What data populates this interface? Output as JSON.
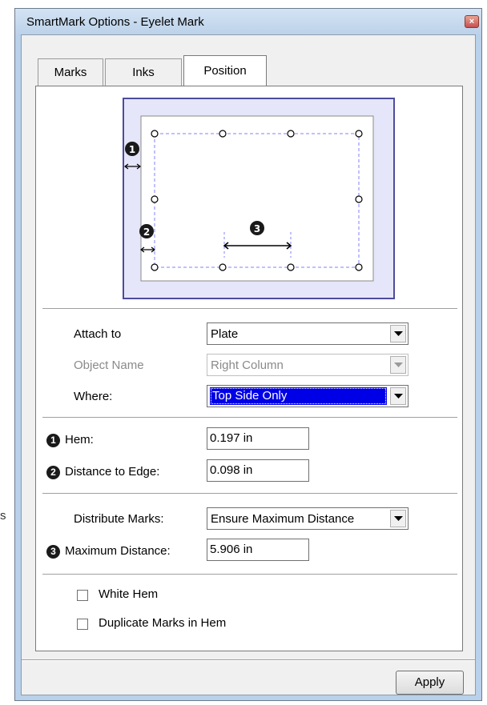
{
  "window": {
    "title": "SmartMark Options - Eyelet Mark",
    "close_symbol": "×"
  },
  "tabs": [
    {
      "label": "Marks",
      "active": false
    },
    {
      "label": "Inks",
      "active": false
    },
    {
      "label": "Position",
      "active": true
    }
  ],
  "preview": {
    "markers": [
      "1",
      "2",
      "3"
    ],
    "icons": [
      "hem-arrow-icon",
      "distance-arrow-icon",
      "max-distance-arrow-icon"
    ]
  },
  "attach_to": {
    "label": "Attach to",
    "value": "Plate"
  },
  "object_name": {
    "label": "Object Name",
    "value": "Right Column"
  },
  "where": {
    "label": "Where:",
    "value": "Top Side Only"
  },
  "hem": {
    "badge": "1",
    "label": "Hem:",
    "value": "0.197 in"
  },
  "distance_to_edge": {
    "badge": "2",
    "label": "Distance to Edge:",
    "value": "0.098 in"
  },
  "distribute_marks": {
    "label": "Distribute Marks:",
    "value": "Ensure Maximum Distance"
  },
  "maximum_distance": {
    "badge": "3",
    "label": "Maximum Distance:",
    "value": "5.906 in"
  },
  "white_hem": {
    "label": "White Hem",
    "checked": false
  },
  "duplicate_marks": {
    "label": "Duplicate Marks in Hem",
    "checked": false
  },
  "apply_button": {
    "label": "Apply"
  },
  "background_fragment": "s",
  "colors": {
    "selection": "#0000e6",
    "preview_outer": "#e6e6fa",
    "preview_border": "#4c4c9e",
    "dashed_line": "#8080ff"
  }
}
